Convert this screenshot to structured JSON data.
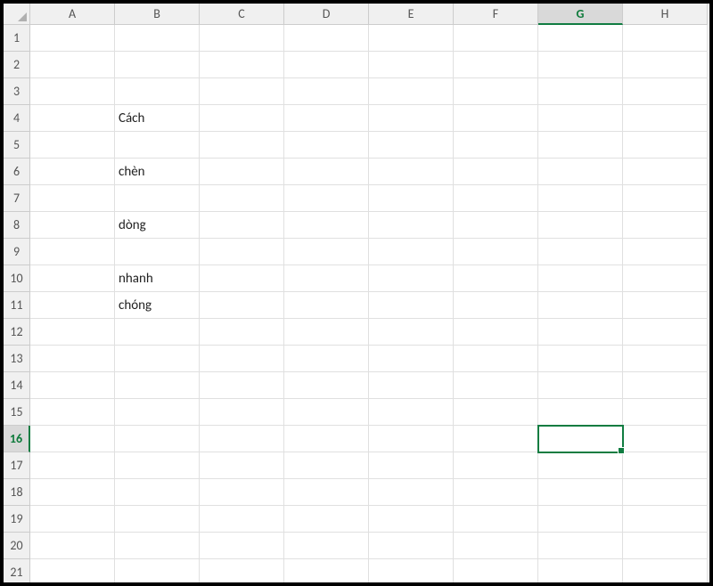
{
  "columns": [
    "A",
    "B",
    "C",
    "D",
    "E",
    "F",
    "G",
    "H"
  ],
  "rows": [
    "1",
    "2",
    "3",
    "4",
    "5",
    "6",
    "7",
    "8",
    "9",
    "10",
    "11",
    "12",
    "13",
    "14",
    "15",
    "16",
    "17",
    "18",
    "19",
    "20",
    "21"
  ],
  "activeColumn": "G",
  "activeRow": "16",
  "selectedCell": {
    "col": "G",
    "row": "16"
  },
  "cells": {
    "B4": "Cách",
    "B6": "chèn",
    "B8": "dòng",
    "B10": "nhanh",
    "B11": "chóng"
  }
}
